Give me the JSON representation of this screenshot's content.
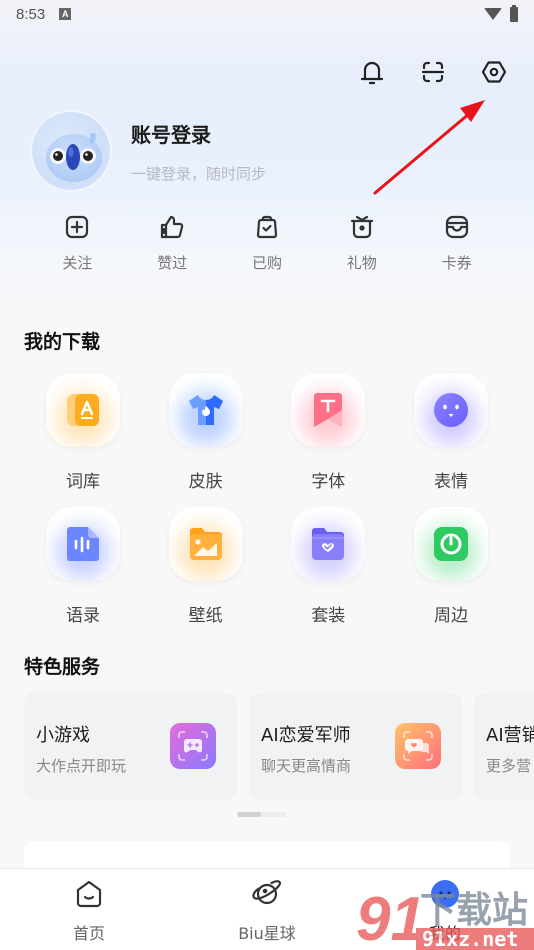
{
  "status_bar": {
    "time": "8:53",
    "notification_badge": "A",
    "icons": [
      "wifi-icon",
      "battery-charging-icon"
    ]
  },
  "header": {
    "actions": [
      {
        "name": "notifications",
        "icon": "bell-icon"
      },
      {
        "name": "scan",
        "icon": "scan-icon"
      },
      {
        "name": "settings",
        "icon": "hexagon-settings-icon"
      }
    ]
  },
  "account": {
    "title": "账号登录",
    "subtitle": "一键登录，随时同步",
    "avatar": "bird-mascot-avatar"
  },
  "quick_links": [
    {
      "label": "关注",
      "icon": "plus-square-icon"
    },
    {
      "label": "赞过",
      "icon": "thumbs-up-icon"
    },
    {
      "label": "已购",
      "icon": "shopping-bag-check-icon"
    },
    {
      "label": "礼物",
      "icon": "gift-icon"
    },
    {
      "label": "卡券",
      "icon": "coupon-icon"
    }
  ],
  "downloads": {
    "title": "我的下载",
    "items": [
      {
        "label": "词库",
        "icon": "dictionary-icon",
        "color": "#ffae2b"
      },
      {
        "label": "皮肤",
        "icon": "tshirt-icon",
        "color": "#3b7bff"
      },
      {
        "label": "字体",
        "icon": "font-bookmark-icon",
        "color": "#ff6b81"
      },
      {
        "label": "表情",
        "icon": "emoji-face-icon",
        "color": "#7a6bff"
      },
      {
        "label": "语录",
        "icon": "voice-doc-icon",
        "color": "#5b78ff"
      },
      {
        "label": "壁纸",
        "icon": "wallpaper-folder-icon",
        "color": "#ffad2e"
      },
      {
        "label": "套装",
        "icon": "bundle-folder-icon",
        "color": "#7b72f6"
      },
      {
        "label": "周边",
        "icon": "merch-power-icon",
        "color": "#2fcb63"
      }
    ]
  },
  "services": {
    "title": "特色服务",
    "cards": [
      {
        "title": "小游戏",
        "subtitle": "大作点开即玩",
        "icon": "gamepad-icon"
      },
      {
        "title": "AI恋爱军师",
        "subtitle": "聊天更高情商",
        "icon": "chat-hearts-icon"
      },
      {
        "title": "AI营销",
        "subtitle": "更多营",
        "icon": "marketing-icon"
      }
    ]
  },
  "tabbar": {
    "tabs": [
      {
        "label": "首页",
        "icon": "home-icon",
        "active": false
      },
      {
        "label": "Biu星球",
        "icon": "planet-icon",
        "active": false
      },
      {
        "label": "我的",
        "icon": "profile-face-icon",
        "active": true
      }
    ]
  },
  "annotation": {
    "type": "red-arrow",
    "points_to": "settings"
  },
  "watermark": {
    "text_cn": "下载站",
    "number": "91",
    "url": "91xz.net"
  }
}
